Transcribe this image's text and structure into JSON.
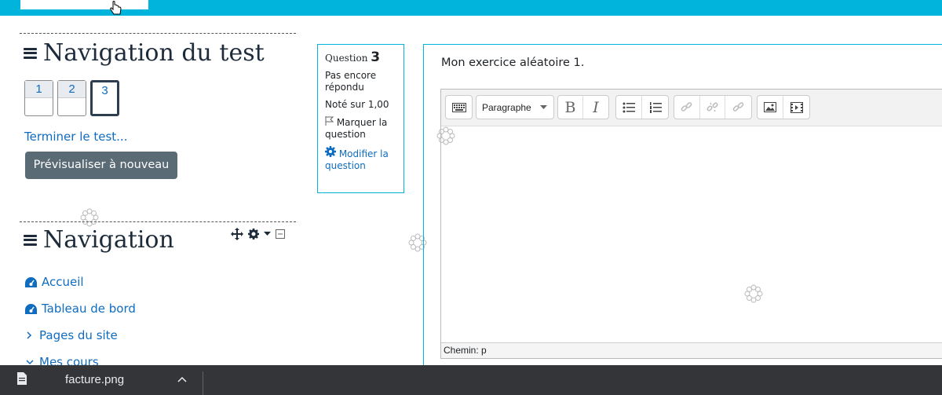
{
  "quiz_nav": {
    "title": "Navigation du test",
    "questions": [
      "1",
      "2",
      "3"
    ],
    "current_question": "3",
    "finish_link": "Terminer le test...",
    "preview_button": "Prévisualiser à nouveau"
  },
  "site_nav": {
    "title": "Navigation",
    "items": [
      {
        "label": "Accueil",
        "icon": "dashboard-icon"
      },
      {
        "label": "Tableau de bord",
        "icon": "dashboard-icon"
      },
      {
        "label": "Pages du site",
        "icon": "chevron-right-icon"
      },
      {
        "label": "Mes cours",
        "icon": "chevron-down-icon"
      }
    ]
  },
  "question_info": {
    "label": "Question",
    "number": "3",
    "status": "Pas encore répondu",
    "grade": "Noté sur 1,00",
    "flag": "Marquer la question",
    "edit": "Modifier la question"
  },
  "question": {
    "text": "Mon exercice aléatoire 1."
  },
  "editor": {
    "paragraph_select": "Paragraphe",
    "bold": "B",
    "italic": "I",
    "path_label": "Chemin: p"
  },
  "download": {
    "file_name": "facture.png"
  },
  "colors": {
    "accent": "#00b4dc",
    "link": "#0f6cbf",
    "button": "#5b6b75",
    "download_bar": "#333539"
  }
}
